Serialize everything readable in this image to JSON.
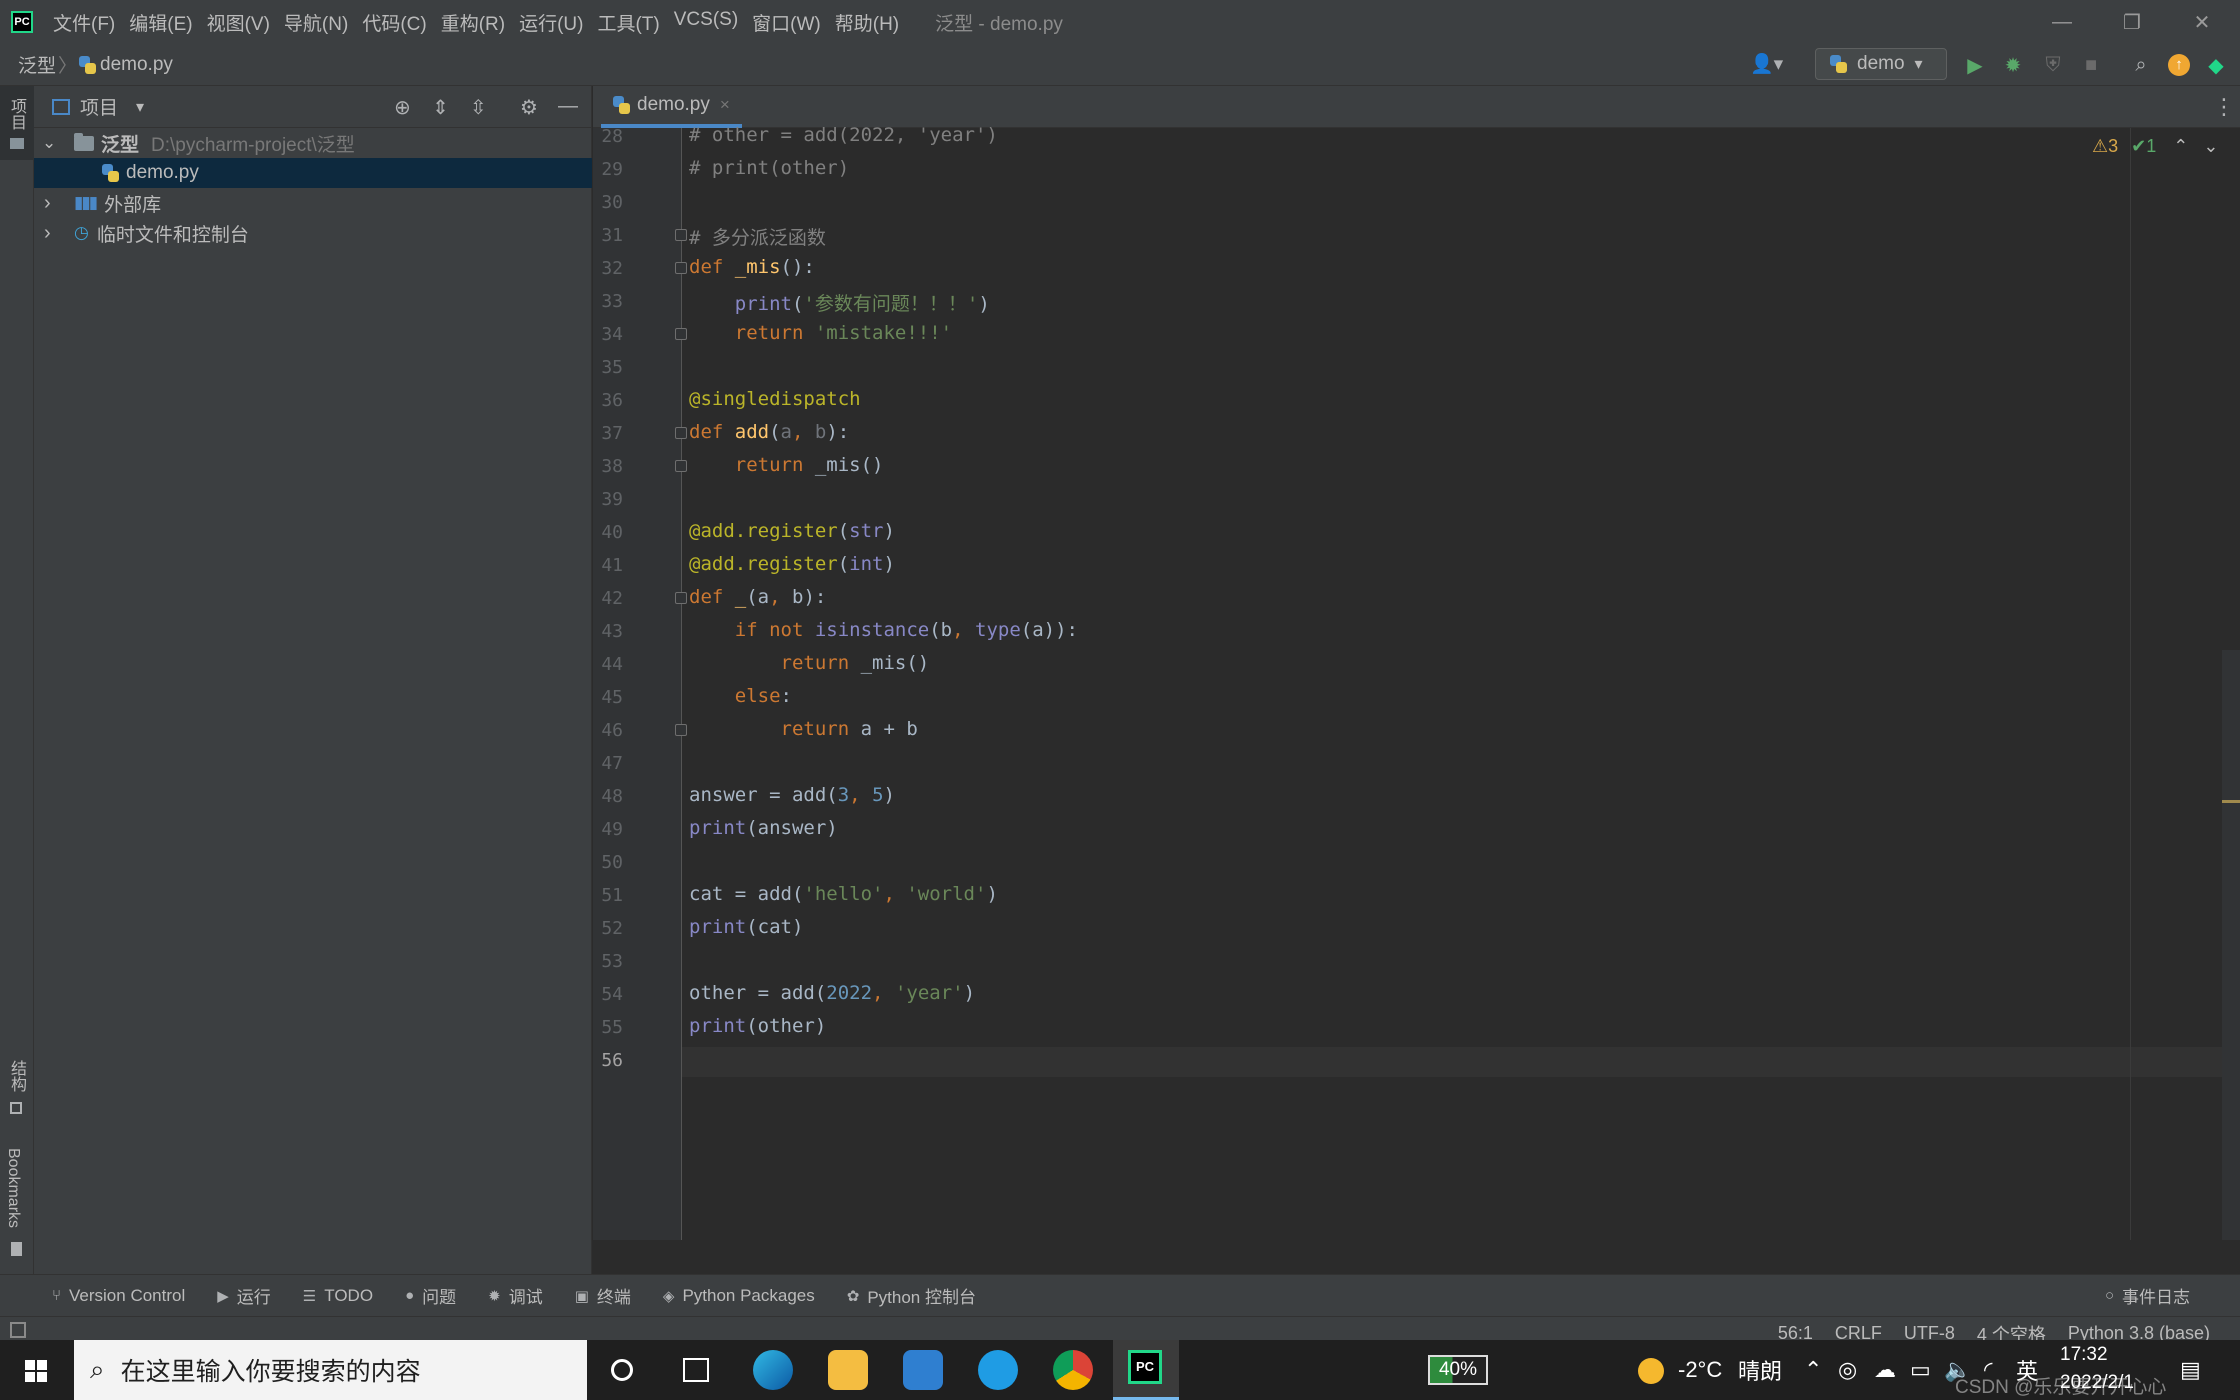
{
  "app": {
    "logo_text": "PC",
    "menu": [
      "文件(F)",
      "编辑(E)",
      "视图(V)",
      "导航(N)",
      "代码(C)",
      "重构(R)",
      "运行(U)",
      "工具(T)",
      "VCS(S)",
      "窗口(W)",
      "帮助(H)"
    ],
    "window_title": "泛型 - demo.py",
    "minimize": "—",
    "restore": "❐",
    "close": "✕"
  },
  "navbar": {
    "crumb_project": "泛型",
    "crumb_sep": "〉",
    "crumb_file": "demo.py",
    "run_config": "demo",
    "run_config_arrow": "▾",
    "user_icon": "👤▾"
  },
  "left_strip": {
    "project_tab": "项目",
    "structure_tab": "结构",
    "bookmarks_tab": "Bookmarks"
  },
  "project_panel": {
    "title": "项目",
    "dropdown": "▾",
    "tree": [
      {
        "label": "泛型",
        "path": "D:\\pycharm-project\\泛型",
        "expander": "⌄"
      },
      {
        "label": "demo.py"
      },
      {
        "label": "外部库",
        "expander": "›"
      },
      {
        "label": "临时文件和控制台",
        "expander": "›"
      }
    ]
  },
  "editor": {
    "tab_label": "demo.py",
    "tab_close": "×",
    "warnings": "⚠3",
    "checks": "✔1",
    "line_numbers": [
      "28",
      "29",
      "30",
      "31",
      "32",
      "33",
      "34",
      "35",
      "36",
      "37",
      "38",
      "39",
      "40",
      "41",
      "42",
      "43",
      "44",
      "45",
      "46",
      "47",
      "48",
      "49",
      "50",
      "51",
      "52",
      "53",
      "54",
      "55",
      "56"
    ],
    "current_line": "56"
  },
  "bottom_tabs": [
    {
      "icon": "⑂",
      "label": "Version Control"
    },
    {
      "icon": "▶",
      "label": "运行"
    },
    {
      "icon": "☰",
      "label": "TODO"
    },
    {
      "icon": "●",
      "label": "问题"
    },
    {
      "icon": "✹",
      "label": "调试"
    },
    {
      "icon": "▣",
      "label": "终端"
    },
    {
      "icon": "◈",
      "label": "Python Packages"
    },
    {
      "icon": "✿",
      "label": "Python 控制台"
    }
  ],
  "event_log": "事件日志",
  "status": {
    "position": "56:1",
    "line_sep": "CRLF",
    "encoding": "UTF-8",
    "indent": "4 个空格",
    "interpreter": "Python 3.8 (base)"
  },
  "taskbar": {
    "search_placeholder": "在这里输入你要搜索的内容",
    "battery": "40%",
    "temperature": "-2°C",
    "weather": "晴朗",
    "ime": "英",
    "time": "17:32",
    "date": "2022/2/1",
    "watermark": "CSDN @乐乐要开开心心"
  },
  "colors": {
    "accent": "#4a88c7",
    "selection": "#0d293e",
    "keyword": "#cc7832",
    "string": "#6a8759",
    "number": "#6897bb"
  }
}
